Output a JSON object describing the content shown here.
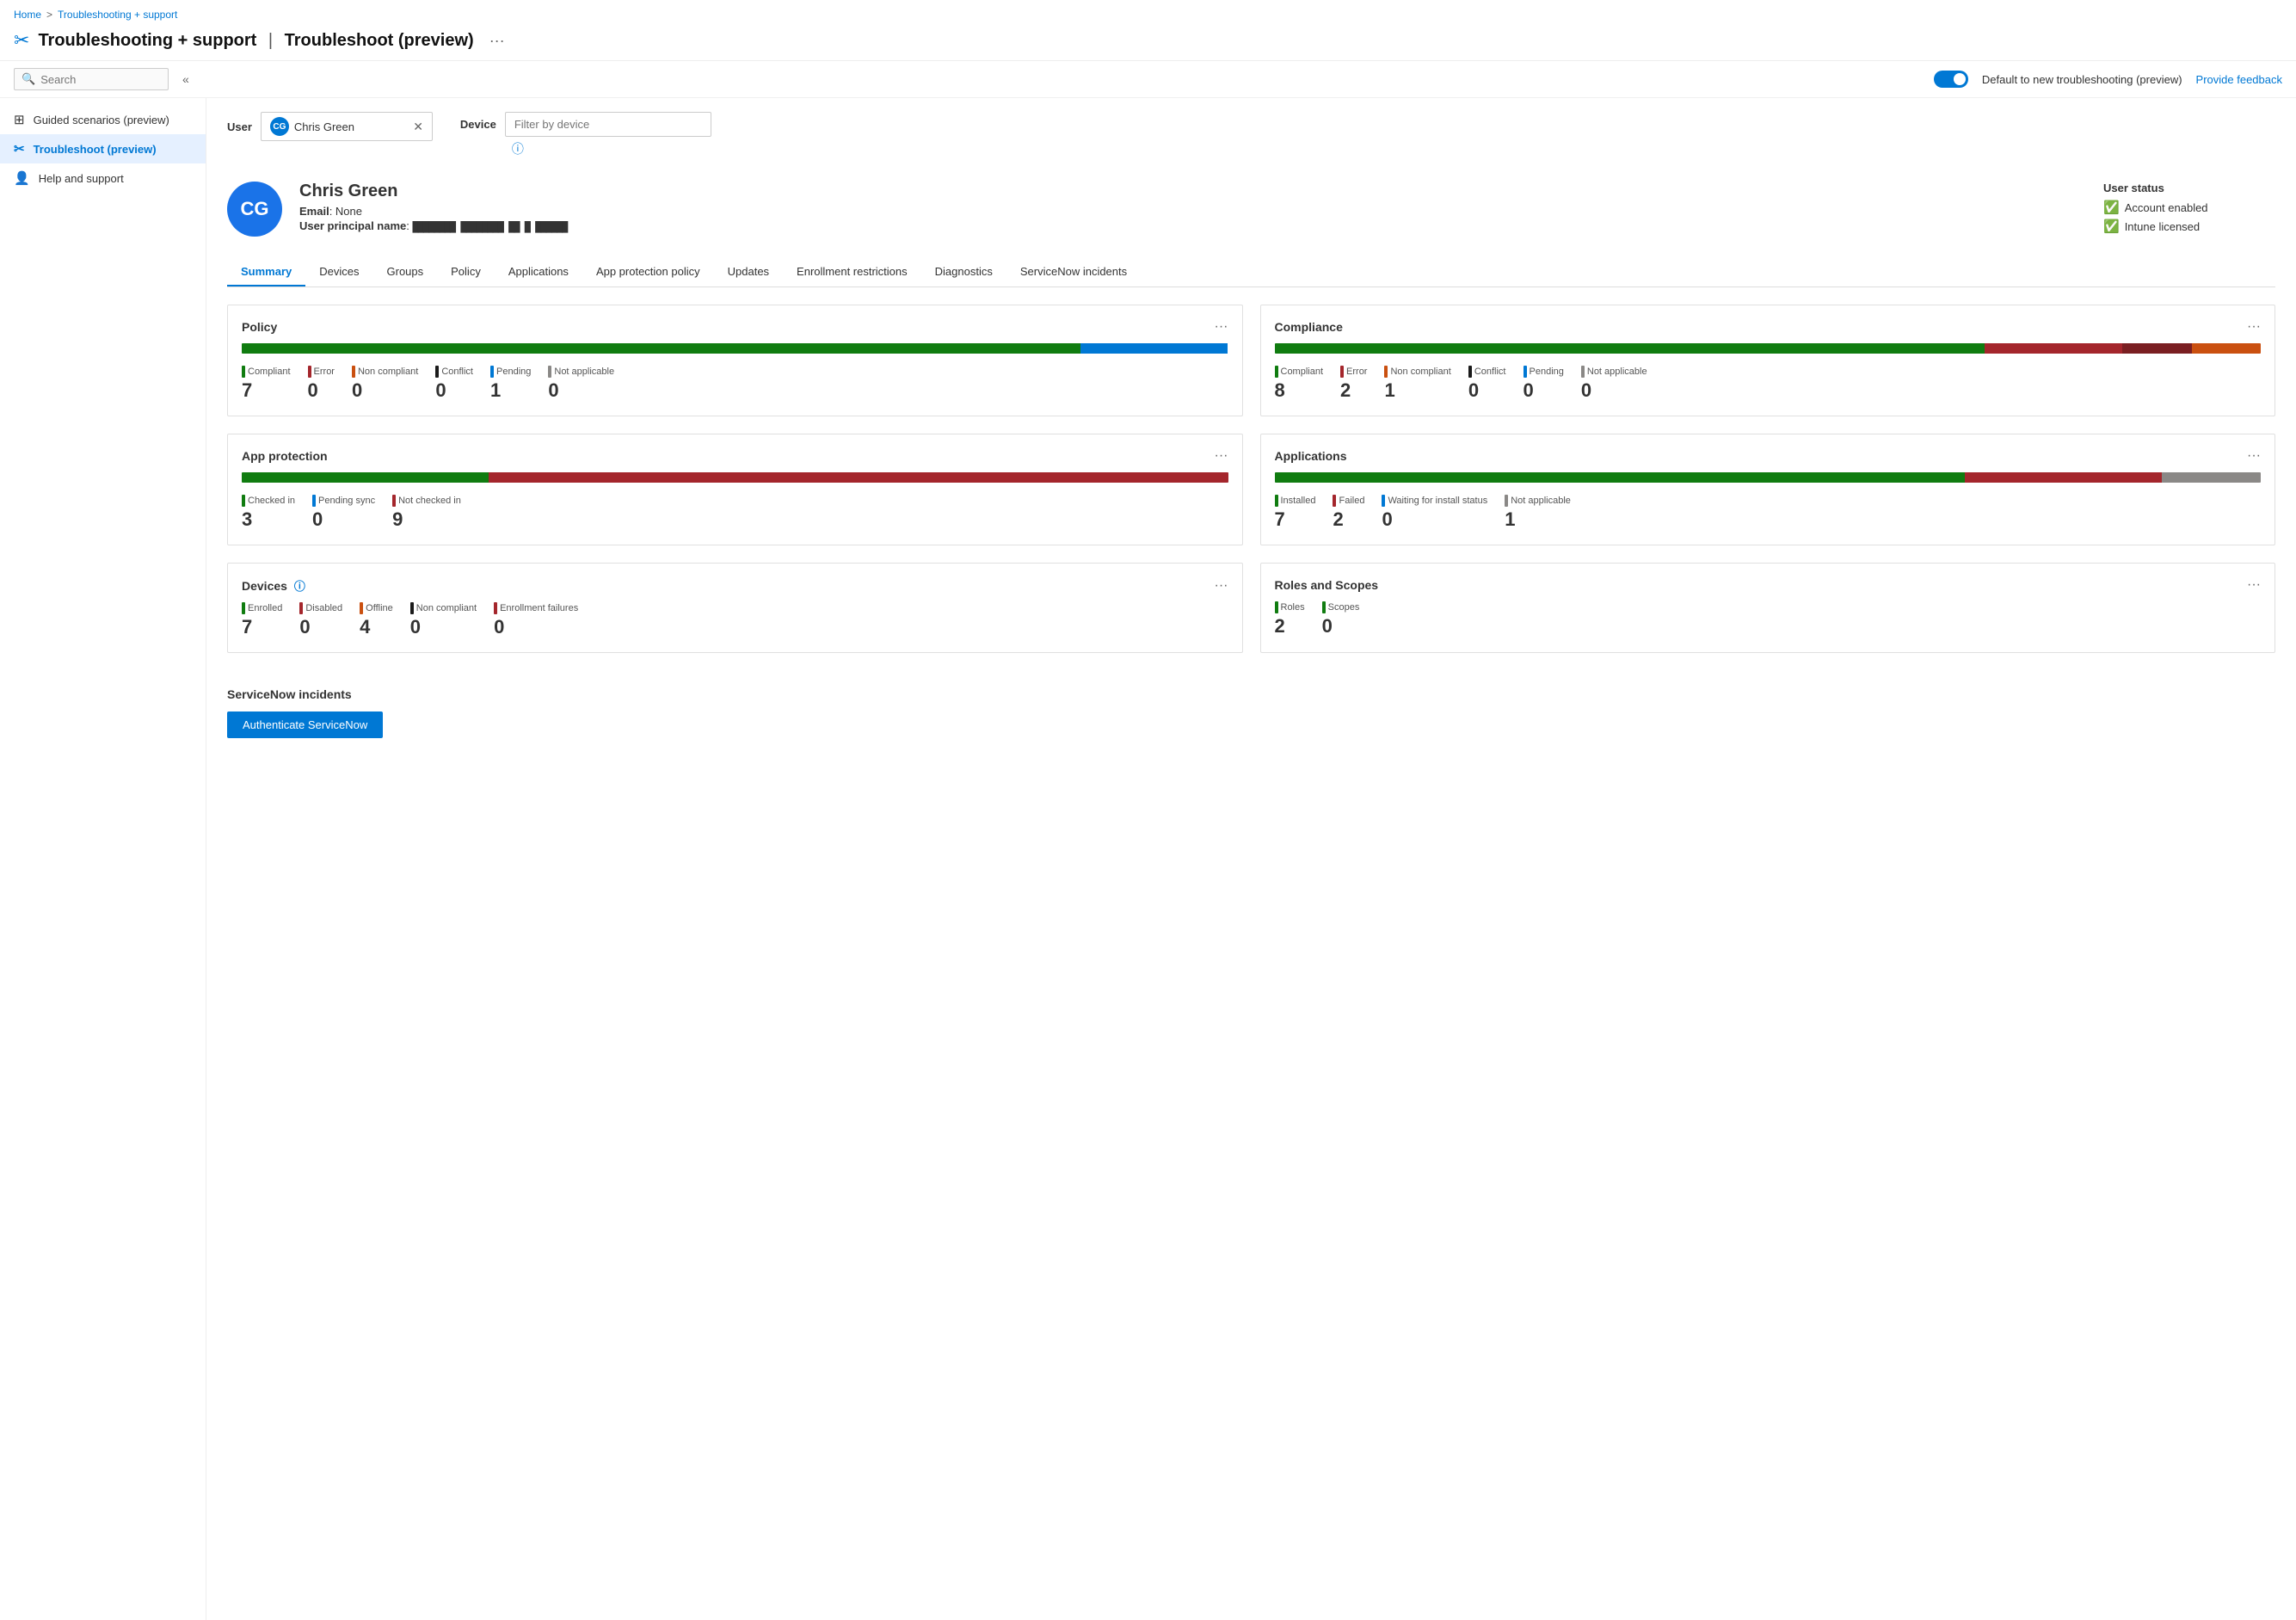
{
  "breadcrumb": {
    "home": "Home",
    "separator": ">",
    "current": "Troubleshooting + support"
  },
  "header": {
    "icon": "🔧",
    "title": "Troubleshooting + support",
    "separator": "|",
    "subtitle": "Troubleshoot (preview)",
    "more_icon": "···"
  },
  "topbar": {
    "search_placeholder": "Search",
    "collapse_icon": "«",
    "toggle_label": "Default to new troubleshooting (preview)",
    "feedback_label": "Provide feedback"
  },
  "sidebar": {
    "items": [
      {
        "id": "guided",
        "icon": "⊞",
        "label": "Guided scenarios (preview)"
      },
      {
        "id": "troubleshoot",
        "icon": "🔧",
        "label": "Troubleshoot (preview)",
        "active": true
      },
      {
        "id": "help",
        "icon": "👤",
        "label": "Help and support"
      }
    ]
  },
  "filter": {
    "user_label": "User",
    "user_name": "Chris Green",
    "user_initials": "CG",
    "device_label": "Device",
    "device_placeholder": "Filter by device",
    "info_icon": "ⓘ"
  },
  "user_profile": {
    "initials": "CG",
    "name": "Chris Green",
    "email_label": "Email",
    "email_value": "None",
    "upn_label": "User principal name",
    "upn_value": "████████ ████████ ██ █ ██████",
    "status_title": "User status",
    "statuses": [
      {
        "label": "Account enabled",
        "icon": "✅"
      },
      {
        "label": "Intune licensed",
        "icon": "✅"
      }
    ]
  },
  "tabs": [
    {
      "id": "summary",
      "label": "Summary",
      "active": true
    },
    {
      "id": "devices",
      "label": "Devices"
    },
    {
      "id": "groups",
      "label": "Groups"
    },
    {
      "id": "policy",
      "label": "Policy"
    },
    {
      "id": "applications",
      "label": "Applications"
    },
    {
      "id": "app-protection",
      "label": "App protection policy"
    },
    {
      "id": "updates",
      "label": "Updates"
    },
    {
      "id": "enrollment",
      "label": "Enrollment restrictions"
    },
    {
      "id": "diagnostics",
      "label": "Diagnostics"
    },
    {
      "id": "servicenow",
      "label": "ServiceNow incidents"
    }
  ],
  "cards": {
    "policy": {
      "title": "Policy",
      "more_icon": "···",
      "bar": [
        {
          "color": "#107c10",
          "pct": 85
        },
        {
          "color": "#0078d4",
          "pct": 15
        }
      ],
      "stats": [
        {
          "label": "Compliant",
          "color": "#107c10",
          "value": "7"
        },
        {
          "label": "Error",
          "color": "#a4262c",
          "value": "0"
        },
        {
          "label": "Non compliant",
          "color": "#ca5010",
          "value": "0"
        },
        {
          "label": "Conflict",
          "color": "#1b1b1b",
          "value": "0"
        },
        {
          "label": "Pending",
          "color": "#0078d4",
          "value": "1"
        },
        {
          "label": "Not applicable",
          "color": "#8a8886",
          "value": "0"
        }
      ]
    },
    "compliance": {
      "title": "Compliance",
      "more_icon": "···",
      "bar": [
        {
          "color": "#107c10",
          "pct": 72
        },
        {
          "color": "#a4262c",
          "pct": 14
        },
        {
          "color": "#7a1f22",
          "pct": 7
        },
        {
          "color": "#ca5010",
          "pct": 7
        }
      ],
      "stats": [
        {
          "label": "Compliant",
          "color": "#107c10",
          "value": "8"
        },
        {
          "label": "Error",
          "color": "#a4262c",
          "value": "2"
        },
        {
          "label": "Non compliant",
          "color": "#ca5010",
          "value": "1"
        },
        {
          "label": "Conflict",
          "color": "#1b1b1b",
          "value": "0"
        },
        {
          "label": "Pending",
          "color": "#0078d4",
          "value": "0"
        },
        {
          "label": "Not applicable",
          "color": "#8a8886",
          "value": "0"
        }
      ]
    },
    "app_protection": {
      "title": "App protection",
      "more_icon": "···",
      "bar": [
        {
          "color": "#107c10",
          "pct": 25
        },
        {
          "color": "#a4262c",
          "pct": 75
        }
      ],
      "stats": [
        {
          "label": "Checked in",
          "color": "#107c10",
          "value": "3"
        },
        {
          "label": "Pending sync",
          "color": "#0078d4",
          "value": "0"
        },
        {
          "label": "Not checked in",
          "color": "#a4262c",
          "value": "9"
        }
      ]
    },
    "applications": {
      "title": "Applications",
      "more_icon": "···",
      "bar": [
        {
          "color": "#107c10",
          "pct": 70
        },
        {
          "color": "#a4262c",
          "pct": 20
        },
        {
          "color": "#8a8886",
          "pct": 10
        }
      ],
      "stats": [
        {
          "label": "Installed",
          "color": "#107c10",
          "value": "7"
        },
        {
          "label": "Failed",
          "color": "#a4262c",
          "value": "2"
        },
        {
          "label": "Waiting for install status",
          "color": "#0078d4",
          "value": "0"
        },
        {
          "label": "Not applicable",
          "color": "#8a8886",
          "value": "1"
        }
      ]
    },
    "devices": {
      "title": "Devices",
      "more_icon": "···",
      "has_info": true,
      "stats": [
        {
          "label": "Enrolled",
          "color": "#107c10",
          "value": "7"
        },
        {
          "label": "Disabled",
          "color": "#a4262c",
          "value": "0"
        },
        {
          "label": "Offline",
          "color": "#ca5010",
          "value": "4"
        },
        {
          "label": "Non compliant",
          "color": "#1b1b1b",
          "value": "0"
        },
        {
          "label": "Enrollment failures",
          "color": "#a4262c",
          "value": "0"
        }
      ]
    },
    "roles_scopes": {
      "title": "Roles and Scopes",
      "more_icon": "···",
      "stats": [
        {
          "label": "Roles",
          "color": "#107c10",
          "value": "2"
        },
        {
          "label": "Scopes",
          "color": "#107c10",
          "value": "0"
        }
      ]
    }
  },
  "servicenow": {
    "title": "ServiceNow incidents",
    "button_label": "Authenticate ServiceNow"
  }
}
